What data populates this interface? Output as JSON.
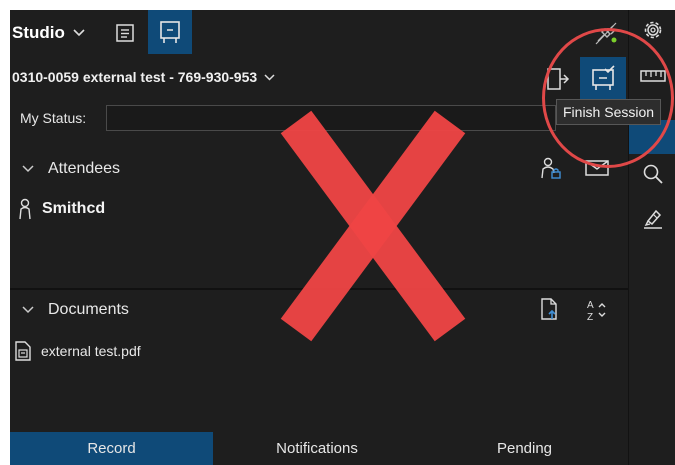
{
  "header": {
    "studio_label": "Studio",
    "session_title": "0310-0059 external test - 769-930-953"
  },
  "status": {
    "label": "My Status:",
    "value": ""
  },
  "attendees": {
    "section_label": "Attendees",
    "items": [
      {
        "name": "Smithcd"
      }
    ]
  },
  "documents": {
    "section_label": "Documents",
    "items": [
      {
        "name": "external test.pdf"
      }
    ]
  },
  "tabs": [
    {
      "label": "Record",
      "active": true
    },
    {
      "label": "Notifications",
      "active": false
    },
    {
      "label": "Pending",
      "active": false
    }
  ],
  "tooltip": {
    "text": "Finish Session"
  },
  "overlay": {
    "letter": "X"
  },
  "colors": {
    "panel_bg": "#1e1e1e",
    "accent": "#0f4a78",
    "overlay_x": "#f04545",
    "highlight_circle": "#e04848",
    "status_dot": "#7ccf2c"
  },
  "icons": {
    "studio_dropdown": "chevron-down-icon",
    "notes_view": "document-lines-icon",
    "whiteboard_view": "whiteboard-icon",
    "connection": "disconnected-plug-icon",
    "settings": "gear-icon",
    "leave": "exit-door-icon",
    "finish": "finish-session-icon",
    "ruler": "ruler-icon",
    "search": "magnifier-icon",
    "markup": "pen-icon",
    "add_attendee": "person-lock-icon",
    "email": "envelope-icon",
    "person": "person-icon",
    "upload_document": "document-upload-icon",
    "sort": "sort-az-icon",
    "pdf_file": "pdf-file-icon"
  }
}
